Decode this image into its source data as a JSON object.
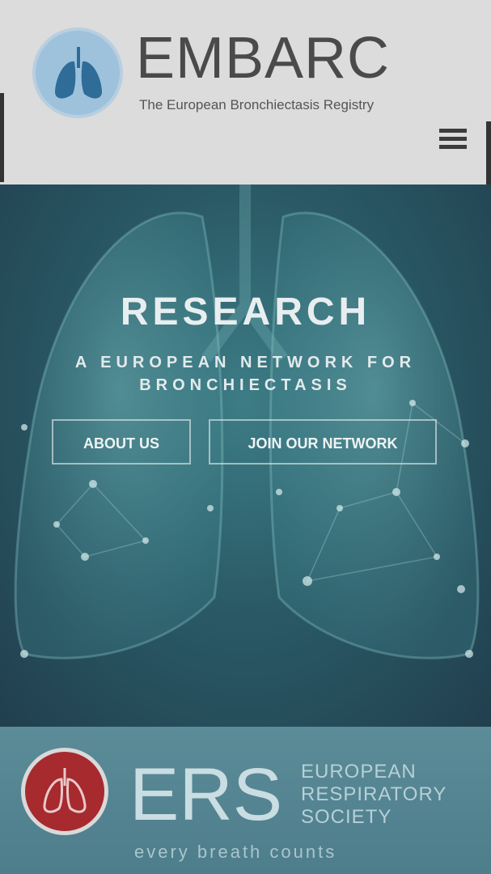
{
  "header": {
    "brand_name": "EMBARC",
    "tagline": "The European Bronchiectasis Registry",
    "menu_icon": "hamburger-menu-icon"
  },
  "hero": {
    "title": "RESEARCH",
    "subtitle": "A EUROPEAN NETWORK FOR BRONCHIECTASIS",
    "buttons": [
      {
        "label": "ABOUT US"
      },
      {
        "label": "JOIN OUR NETWORK"
      }
    ]
  },
  "partner": {
    "abbr": "ERS",
    "full_name_lines": [
      "EUROPEAN",
      "RESPIRATORY",
      "SOCIETY"
    ],
    "tagline": "every breath counts"
  },
  "colors": {
    "header_bg": "#dcdcdc",
    "hero_bg": "#2a5a66",
    "ers_bg": "#5b8c98",
    "ers_logo_red": "#a62a2e",
    "logo_blue": "#9ec2dc"
  }
}
